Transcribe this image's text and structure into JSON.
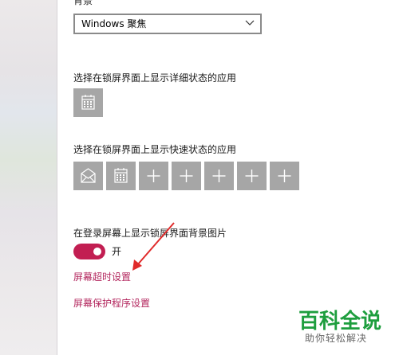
{
  "background": {
    "label": "背景",
    "selected": "Windows 聚焦"
  },
  "detailed_status": {
    "label": "选择在锁屏界面上显示详细状态的应用",
    "app_icon": "calendar-icon"
  },
  "quick_status": {
    "label": "选择在锁屏界面上显示快速状态的应用",
    "tiles": [
      "mail-icon",
      "calendar-icon",
      "plus-icon",
      "plus-icon",
      "plus-icon",
      "plus-icon",
      "plus-icon"
    ]
  },
  "signin_background": {
    "label": "在登录屏幕上显示锁屏界面背景图片",
    "toggle_state": "开",
    "toggle_on": true
  },
  "links": {
    "screen_timeout": "屏幕超时设置",
    "screen_saver": "屏幕保护程序设置"
  },
  "watermark": {
    "logo": "百科全说",
    "tagline": "助你轻松解决"
  },
  "colors": {
    "accent": "#c21e52",
    "link": "#b3275e",
    "tile": "#a6a6a6",
    "annotation": "#e02a2a",
    "watermark_green": "#1e9e3e"
  }
}
